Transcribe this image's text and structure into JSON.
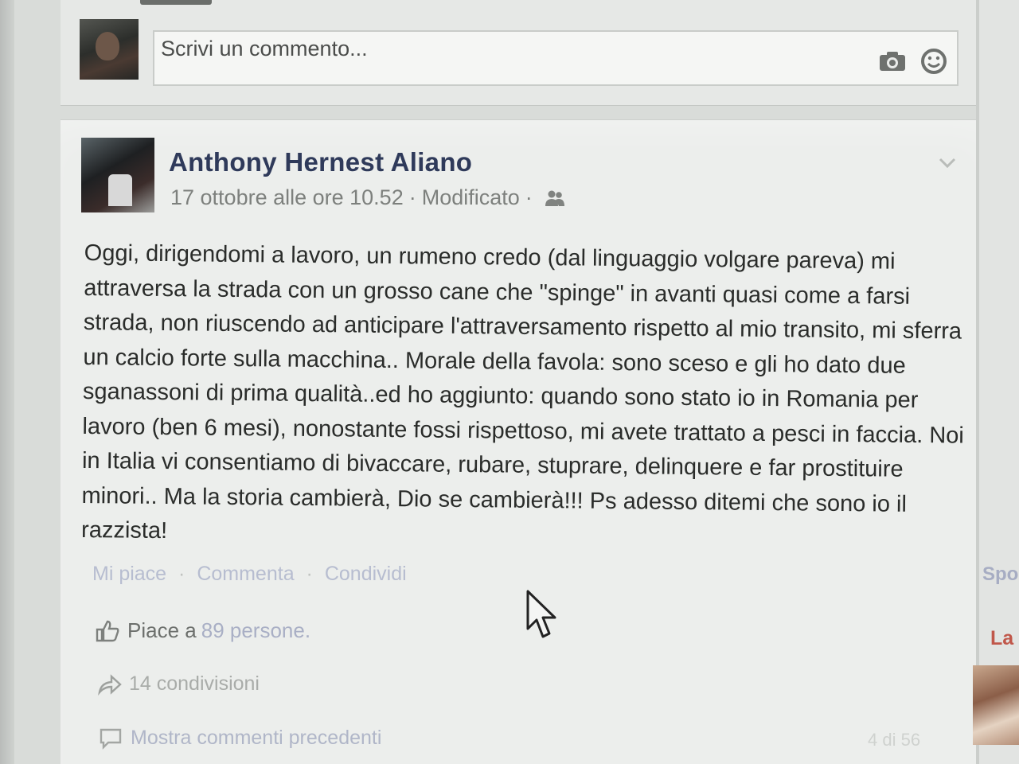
{
  "composer": {
    "placeholder": "Scrivi un commento...",
    "icons": [
      "camera-icon",
      "smiley-icon"
    ]
  },
  "post": {
    "author": "Anthony Hernest Aliano",
    "date": "17 ottobre alle ore 10.52",
    "separator": "·",
    "edited": "Modificato",
    "audience_icon": "friends-icon",
    "body": "Oggi, dirigendomi a lavoro, un rumeno credo (dal linguaggio volgare pareva) mi attraversa la strada con un grosso cane che \"spinge\" in avanti quasi come a farsi strada, non riuscendo ad anticipare l'attraversamento rispetto al mio transito, mi sferra un calcio forte sulla macchina.. Morale della favola: sono sceso e gli ho dato due sganassoni di prima qualità..ed ho aggiunto: quando sono stato io in Romania per lavoro (ben 6 mesi), nonostante fossi rispettoso, mi avete trattato a pesci in faccia. Noi in Italia vi consentiamo di bivaccare, rubare, stuprare, delinquere e far prostituire minori.. Ma la storia cambierà, Dio se cambierà!!! Ps adesso ditemi che sono io il razzista!",
    "actions": {
      "like": "Mi piace",
      "comment": "Commenta",
      "share": "Condividi",
      "dot": "·"
    },
    "likes": {
      "prefix": "Piace a",
      "link": "89 persone."
    },
    "shares": "14 condivisioni",
    "comments": {
      "show_previous": "Mostra commenti precedenti",
      "count": "4 di 56"
    }
  },
  "sidebar": {
    "sponsored": "Spo",
    "ad_title": "La"
  },
  "colors": {
    "author": "#2f3a5a",
    "link": "#a9afc5",
    "ad_title": "#c0574a"
  }
}
